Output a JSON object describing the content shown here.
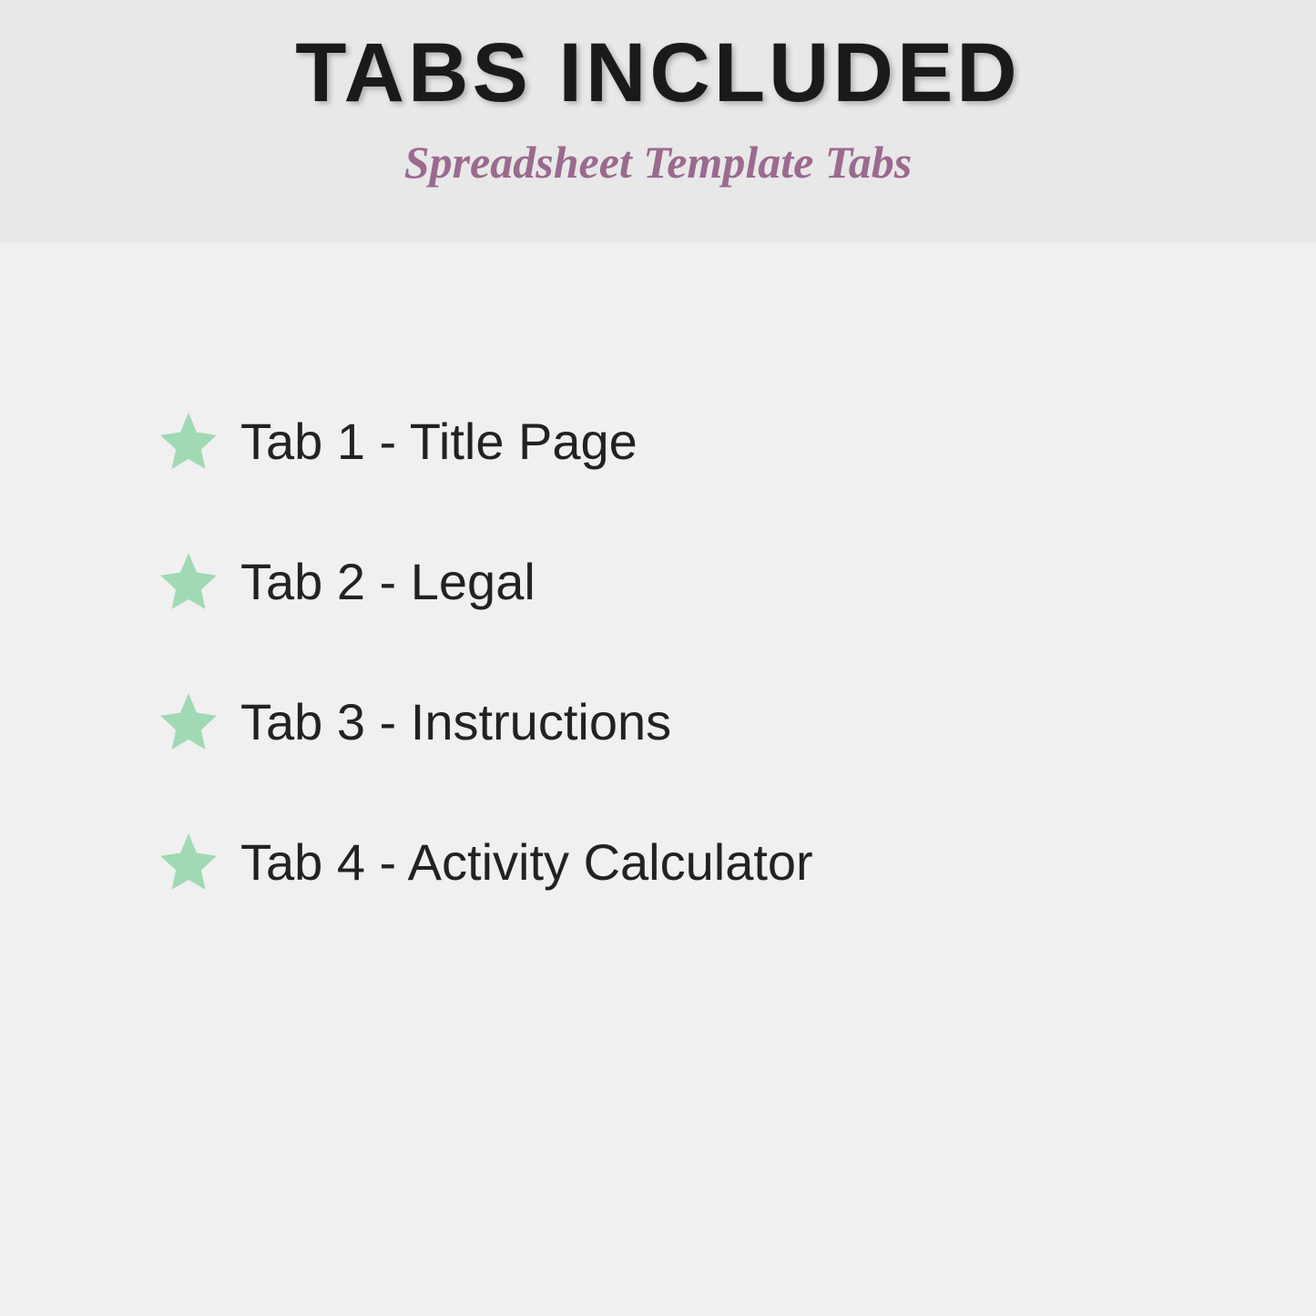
{
  "header": {
    "title": "TABS INCLUDED",
    "subtitle": "Spreadsheet Template Tabs"
  },
  "colors": {
    "star": "#a0d9b4",
    "subtitle": "#9b6a8f"
  },
  "tabs": [
    {
      "label": "Tab 1 - Title Page"
    },
    {
      "label": "Tab 2 - Legal"
    },
    {
      "label": "Tab 3 - Instructions"
    },
    {
      "label": "Tab 4 - Activity Calculator"
    }
  ]
}
